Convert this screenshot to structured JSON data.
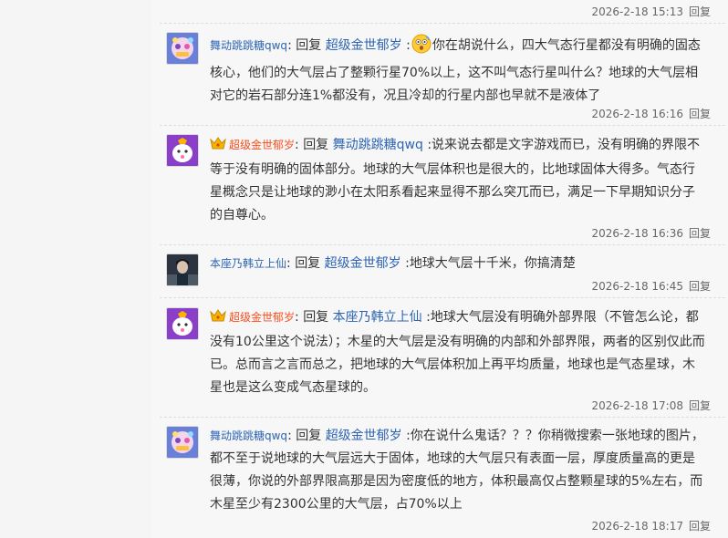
{
  "reply_word": "回复",
  "reply_link": "回复",
  "posts": [
    {
      "time": "2026-2-18 15:13",
      "has_body": false
    },
    {
      "user": "舞动跳跳糖qwq",
      "avatar": "avatar-a",
      "vip": false,
      "target": "超级金世郁岁",
      "sep": ":",
      "emoji": "surprised-emoji",
      "content": "你在胡说什么，四大气态行星都没有明确的固态核心，他们的大气层占了整颗行星70%以上，这不叫气态行星叫什么？地球的大气层相对它的岩石部分连1%都没有，况且冷却的行星内部也早就不是液体了",
      "time": "2026-2-18 16:16"
    },
    {
      "user": "超级金世郁岁",
      "avatar": "avatar-b",
      "vip": true,
      "crown_icon": "crown-icon",
      "target": "舞动跳跳糖qwq",
      "sep": ":",
      "content": "说来说去都是文字游戏而已，没有明确的界限不等于没有明确的固体部分。地球的大气层体积也是很大的，比地球固体大得多。气态行星概念只是让地球的渺小在太阳系看起来显得不那么突兀而已，满足一下早期知识分子的自尊心。",
      "time": "2026-2-18 16:36"
    },
    {
      "user": "本座乃韩立上仙",
      "avatar": "avatar-c",
      "vip": false,
      "target": "超级金世郁岁",
      "sep": ":",
      "content": "地球大气层十千米，你搞清楚",
      "time": "2026-2-18 16:45"
    },
    {
      "user": "超级金世郁岁",
      "avatar": "avatar-b",
      "vip": true,
      "crown_icon": "crown-icon",
      "target": "本座乃韩立上仙",
      "sep": ":",
      "content": "地球大气层没有明确外部界限（不管怎么论，都没有10公里这个说法）；木星的大气层是没有明确的内部和外部界限，两者的区别仅此而已。总而言之言而总之，把地球的大气层体积加上再平均质量，地球也是气态星球，木星也是这么变成气态星球的。",
      "time": "2026-2-18 17:08"
    },
    {
      "user": "舞动跳跳糖qwq",
      "avatar": "avatar-a",
      "vip": false,
      "target": "超级金世郁岁",
      "sep": ":",
      "content": "你在说什么鬼话？？？你稍微搜索一张地球的图片，都不至于说地球的大气层远大于固体，地球的大气层只有表面一层，厚度质量高的更是很薄，你说的外部界限高那是因为密度低的地方，体积最高仅占整颗星球的5%左右，而木星至少有2300公里的大气层，占70%以上",
      "time": "2026-2-18 18:17"
    }
  ]
}
